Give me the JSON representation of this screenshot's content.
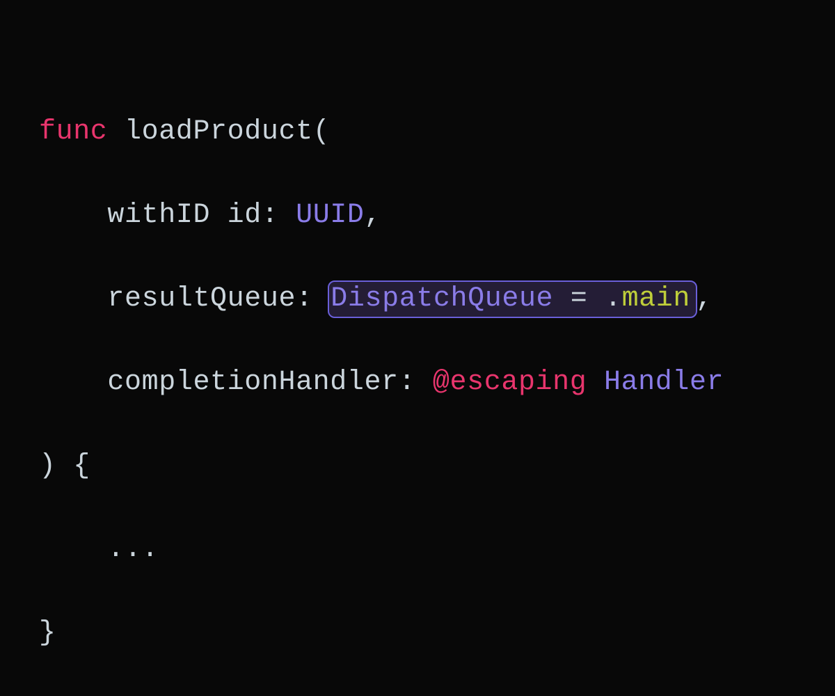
{
  "colors": {
    "background": "#080808",
    "keyword_pink": "#e8356d",
    "identifier": "#cbd5dc",
    "type_purple": "#8a7ce8",
    "property_yellow": "#bfce3a",
    "highlight_bg": "rgba(70,55,110,0.45)",
    "highlight_border": "#6a5fd9"
  },
  "code": {
    "line1": {
      "keyword": "func",
      "space1": " ",
      "funcname": "loadProduct",
      "paren_open": "("
    },
    "line2": {
      "indent": "    ",
      "label": "withID",
      "space1": " ",
      "param": "id",
      "colon": ": ",
      "type": "UUID",
      "comma": ","
    },
    "line3": {
      "indent": "    ",
      "param": "resultQueue",
      "colon": ": ",
      "highlight": {
        "type": "DispatchQueue",
        "eq": " = ",
        "dot": ".",
        "prop": "main"
      },
      "comma": ","
    },
    "line4": {
      "indent": "    ",
      "param": "completionHandler",
      "colon": ": ",
      "annotation": "@escaping",
      "space1": " ",
      "type": "Handler"
    },
    "line5": {
      "paren_close": ")",
      "space1": " ",
      "brace_open": "{"
    },
    "line6": {
      "indent": "    ",
      "ellipsis": "..."
    },
    "line7": {
      "brace_close": "}"
    }
  }
}
